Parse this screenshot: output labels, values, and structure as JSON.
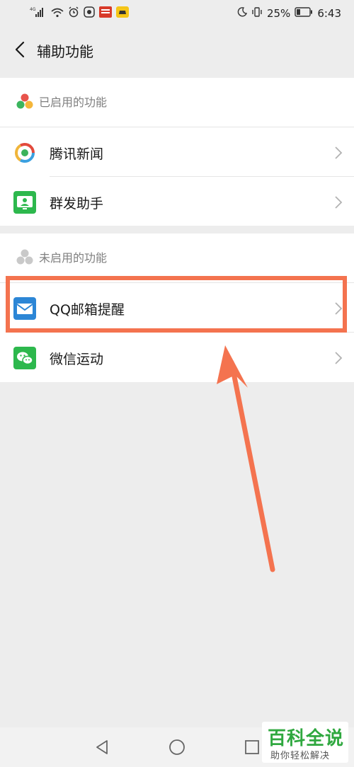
{
  "status_bar": {
    "network": "4G",
    "battery_percent": "25%",
    "time": "6:43"
  },
  "header": {
    "title": "辅助功能"
  },
  "enabled_section": {
    "label": "已启用的功能",
    "items": [
      {
        "label": "腾讯新闻",
        "icon": "tencent-news-icon"
      },
      {
        "label": "群发助手",
        "icon": "broadcast-assistant-icon"
      }
    ]
  },
  "disabled_section": {
    "label": "未启用的功能",
    "items": [
      {
        "label": "QQ邮箱提醒",
        "icon": "qq-mail-icon"
      },
      {
        "label": "微信运动",
        "icon": "wechat-sports-icon"
      }
    ]
  },
  "annotation": {
    "highlight_color": "#f4734f"
  },
  "watermark": {
    "title": "百科全说",
    "subtitle": "助你轻松解决"
  },
  "colors": {
    "background": "#ededed",
    "card": "#ffffff",
    "mail_blue": "#2c86d6",
    "green": "#2db84d",
    "accent_orange": "#f4734f"
  }
}
